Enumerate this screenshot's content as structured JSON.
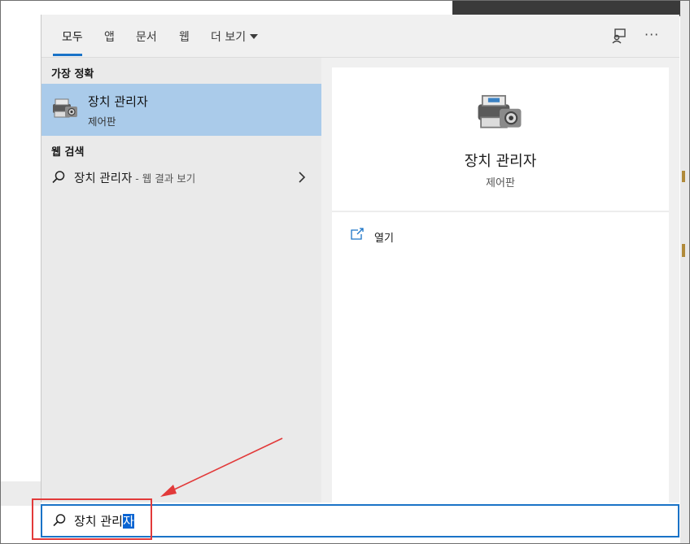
{
  "tabs": [
    {
      "label": "모두",
      "active": true
    },
    {
      "label": "앱"
    },
    {
      "label": "문서"
    },
    {
      "label": "웹"
    },
    {
      "label": "더 보기"
    }
  ],
  "top_icons": [
    "feedback-icon",
    "more-options-icon"
  ],
  "top_icon_text": {
    "more": "···"
  },
  "left": {
    "best_match_header": "가장 정확",
    "best_match": {
      "title": "장치 관리자",
      "subtitle": "제어판",
      "icon": "device-manager-icon"
    },
    "web_header": "웹 검색",
    "web_item": {
      "query": "장치 관리자",
      "suffix": " - 웹 결과 보기",
      "icon": "search-icon"
    }
  },
  "right": {
    "title": "장치 관리자",
    "subtitle": "제어판",
    "actions": [
      {
        "label": "열기",
        "icon": "open-icon"
      }
    ]
  },
  "search": {
    "typed": "장치 관리",
    "selected": "자",
    "icon": "search-icon"
  },
  "colors": {
    "accent": "#1a73c7",
    "selection_bg": "#aacbea",
    "annotation": "#e23a3a"
  }
}
